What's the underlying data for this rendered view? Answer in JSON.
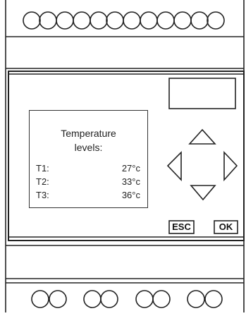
{
  "display": {
    "title_line1": "Temperature",
    "title_line2": "levels:",
    "readings": [
      {
        "label": "T1:",
        "value": "27°c"
      },
      {
        "label": "T2:",
        "value": "33°c"
      },
      {
        "label": "T3:",
        "value": "36°c"
      }
    ]
  },
  "buttons": {
    "esc_label": "ESC",
    "ok_label": "OK"
  },
  "icons": {
    "up": "triangle-up-icon",
    "down": "triangle-down-icon",
    "left": "triangle-left-icon",
    "right": "triangle-right-icon"
  }
}
